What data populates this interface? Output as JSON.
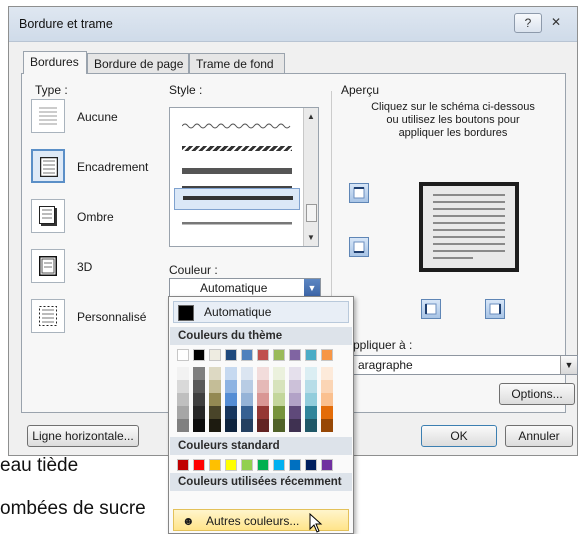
{
  "document": {
    "line1": "eau tiède",
    "line2": "ombées de sucre"
  },
  "dialog": {
    "title": "Bordure et trame",
    "help_glyph": "?",
    "close_glyph": "✕",
    "tabs": [
      {
        "label": "Bordures",
        "active": true
      },
      {
        "label": "Bordure de page",
        "active": false
      },
      {
        "label": "Trame de fond",
        "active": false
      }
    ],
    "type_label": "Type :",
    "types": [
      {
        "label": "Aucune",
        "selected": false
      },
      {
        "label": "Encadrement",
        "selected": true
      },
      {
        "label": "Ombre",
        "selected": false
      },
      {
        "label": "3D",
        "selected": false
      },
      {
        "label": "Personnalisé",
        "selected": false
      }
    ],
    "style_label": "Style :",
    "color_label": "Couleur :",
    "color_value": "Automatique",
    "preview_label": "Aperçu",
    "preview_instructions": [
      "Cliquez sur le schéma ci-dessous",
      "ou utilisez les boutons pour",
      "appliquer les bordures"
    ],
    "apply_label": "ppliquer à :",
    "apply_value": "aragraphe",
    "options_button": "Options...",
    "horizontal_line_button": "Ligne horizontale...",
    "ok_button": "OK",
    "cancel_button": "Annuler"
  },
  "color_menu": {
    "automatic_label": "Automatique",
    "theme_header": "Couleurs du thème",
    "standard_header": "Couleurs standard",
    "recent_header": "Couleurs utilisées récemment",
    "more_colors": "Autres couleurs...",
    "theme_top": [
      "#ffffff",
      "#000000",
      "#eeece1",
      "#1f497d",
      "#4f81bd",
      "#c0504d",
      "#9bbb59",
      "#8064a2",
      "#4bacc6",
      "#f79646"
    ],
    "theme_columns": [
      [
        "#f2f2f2",
        "#d9d9d9",
        "#bfbfbf",
        "#a6a6a6",
        "#808080"
      ],
      [
        "#7f7f7f",
        "#595959",
        "#3f3f3f",
        "#262626",
        "#0d0d0d"
      ],
      [
        "#ddd9c3",
        "#c4bd97",
        "#938953",
        "#494429",
        "#1d1b10"
      ],
      [
        "#c6d9f0",
        "#8db3e2",
        "#548dd4",
        "#17365d",
        "#0f243e"
      ],
      [
        "#dbe5f1",
        "#b8cce4",
        "#95b3d7",
        "#366092",
        "#244061"
      ],
      [
        "#f2dcdb",
        "#e5b9b7",
        "#d99694",
        "#953734",
        "#632423"
      ],
      [
        "#ebf1dd",
        "#d7e3bc",
        "#c3d69b",
        "#76923c",
        "#4f6128"
      ],
      [
        "#e5e0ec",
        "#ccc1d9",
        "#b2a2c7",
        "#5f497a",
        "#3f3151"
      ],
      [
        "#dbeef3",
        "#b7dde8",
        "#92cddc",
        "#31859b",
        "#205867"
      ],
      [
        "#fdeada",
        "#fbd5b5",
        "#fac08f",
        "#e36c09",
        "#974806"
      ]
    ],
    "standard": [
      "#c00000",
      "#ff0000",
      "#ffc000",
      "#ffff00",
      "#92d050",
      "#00b050",
      "#00b0f0",
      "#0070c0",
      "#002060",
      "#7030a0"
    ]
  }
}
